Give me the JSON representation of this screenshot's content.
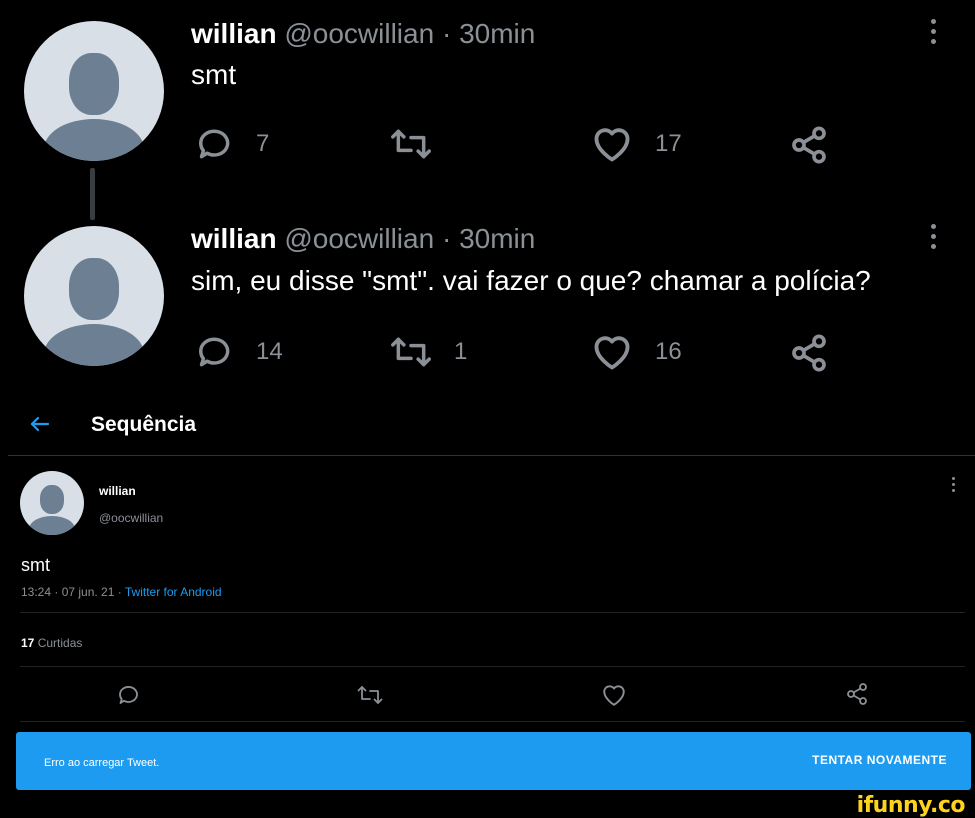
{
  "tweets": [
    {
      "name": "willian",
      "handle": "@oocwillian",
      "time": "· 30min",
      "text": "smt",
      "replies": "7",
      "retweets": "",
      "likes": "17"
    },
    {
      "name": "willian",
      "handle": "@oocwillian",
      "time": "· 30min",
      "text": "sim, eu disse \"smt\". vai fazer o que? chamar a polícia?",
      "replies": "14",
      "retweets": "1",
      "likes": "16"
    }
  ],
  "thread": {
    "header_title": "Sequência",
    "author_name": "willian",
    "author_handle": "@oocwillian",
    "text": "smt",
    "timestamp": "13:24 · 07 jun. 21 ·",
    "source": "Twitter for Android",
    "likes_count": "17",
    "likes_label": "Curtidas"
  },
  "snackbar": {
    "message": "Erro ao carregar Tweet.",
    "action": "TENTAR NOVAMENTE"
  },
  "watermark": "ifunny.co",
  "colors": {
    "accent": "#1d9bf0",
    "background": "#000000",
    "muted": "#8b9096",
    "watermark": "#ffd21f"
  }
}
